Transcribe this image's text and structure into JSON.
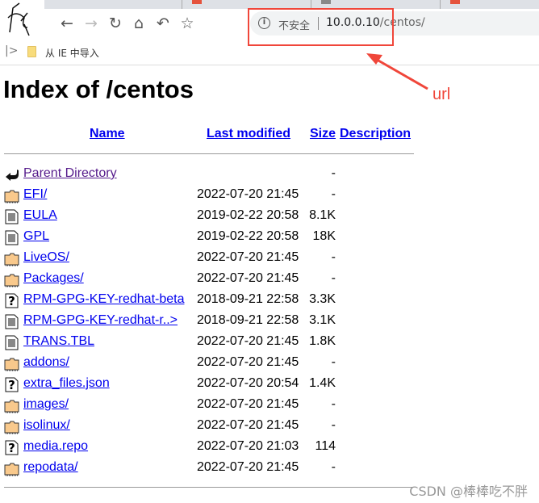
{
  "browser": {
    "address": {
      "insecure_label": "不安全",
      "host": "10.0.0.10",
      "path": "/centos/"
    },
    "nav_icons": [
      "back-icon",
      "forward-icon",
      "reload-icon",
      "home-icon",
      "undo-icon",
      "star-icon"
    ],
    "bookmarks": [
      {
        "label": "从 IE 中导入",
        "icon": "folder-icon"
      }
    ]
  },
  "page": {
    "title": "Index of /centos",
    "columns": [
      "Name",
      "Last modified",
      "Size",
      "Description"
    ],
    "rows": [
      {
        "name": "Parent Directory",
        "date": "",
        "size": "-",
        "icon": "back"
      },
      {
        "name": "EFI/",
        "date": "2022-07-20 21:45",
        "size": "-",
        "icon": "folder"
      },
      {
        "name": "EULA",
        "date": "2019-02-22 20:58",
        "size": "8.1K",
        "icon": "text"
      },
      {
        "name": "GPL",
        "date": "2019-02-22 20:58",
        "size": "18K",
        "icon": "text"
      },
      {
        "name": "LiveOS/",
        "date": "2022-07-20 21:45",
        "size": "-",
        "icon": "folder"
      },
      {
        "name": "Packages/",
        "date": "2022-07-20 21:45",
        "size": "-",
        "icon": "folder"
      },
      {
        "name": "RPM-GPG-KEY-redhat-beta",
        "date": "2018-09-21 22:58",
        "size": "3.3K",
        "icon": "unknown"
      },
      {
        "name": "RPM-GPG-KEY-redhat-r..>",
        "date": "2018-09-21 22:58",
        "size": "3.1K",
        "icon": "text"
      },
      {
        "name": "TRANS.TBL",
        "date": "2022-07-20 21:45",
        "size": "1.8K",
        "icon": "text"
      },
      {
        "name": "addons/",
        "date": "2022-07-20 21:45",
        "size": "-",
        "icon": "folder"
      },
      {
        "name": "extra_files.json",
        "date": "2022-07-20 20:54",
        "size": "1.4K",
        "icon": "unknown"
      },
      {
        "name": "images/",
        "date": "2022-07-20 21:45",
        "size": "-",
        "icon": "folder"
      },
      {
        "name": "isolinux/",
        "date": "2022-07-20 21:45",
        "size": "-",
        "icon": "folder"
      },
      {
        "name": "media.repo",
        "date": "2022-07-20 21:03",
        "size": "114",
        "icon": "unknown"
      },
      {
        "name": "repodata/",
        "date": "2022-07-20 21:45",
        "size": "-",
        "icon": "folder"
      }
    ]
  },
  "annotation": {
    "label": "url",
    "color": "#f0463a"
  },
  "watermark": "CSDN @棒棒吃不胖"
}
